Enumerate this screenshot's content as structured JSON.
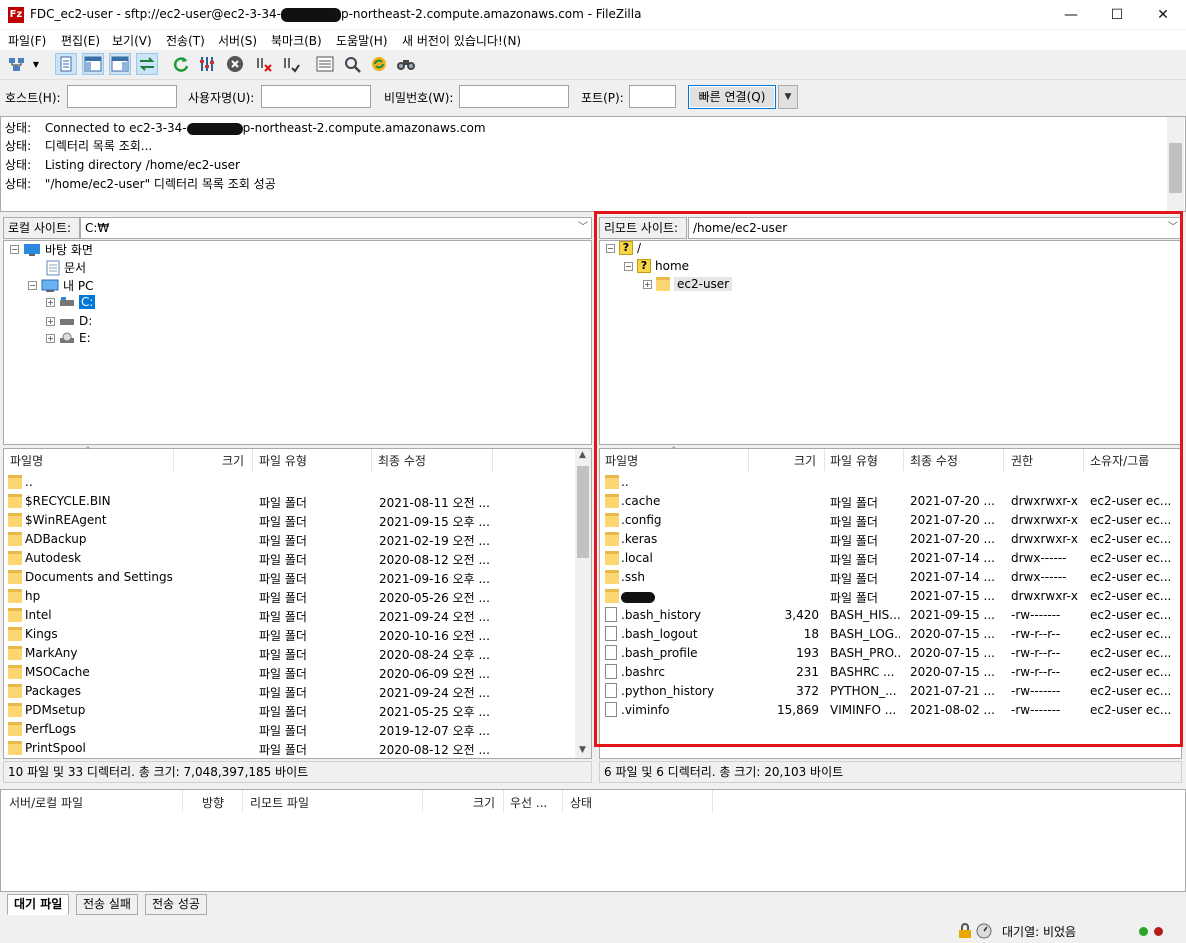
{
  "window": {
    "title_prefix": "FDC_ec2-user - sftp://ec2-user@ec2-3-34-",
    "title_suffix": "p-northeast-2.compute.amazonaws.com - FileZilla",
    "app_icon": "Fz",
    "controls": [
      "—",
      "☐",
      "✕"
    ]
  },
  "menu": [
    "파일(F)",
    "편집(E)",
    "보기(V)",
    "전송(T)",
    "서버(S)",
    "북마크(B)",
    "도움말(H)",
    "새 버전이 있습니다!(N)"
  ],
  "toolbar": {
    "icons": [
      "site-manager-icon",
      "dropdown-arrow-icon",
      "toggle-message-log-icon",
      "toggle-local-tree-icon",
      "toggle-remote-tree-icon",
      "toggle-transfer-queue-icon",
      "refresh-icon",
      "process-queue-icon",
      "cancel-icon",
      "disconnect-icon",
      "reconnect-icon",
      "directory-listing-filter-icon",
      "toggle-comparison-icon",
      "sync-browsing-icon",
      "search-binoculars-icon"
    ]
  },
  "quickconnect": {
    "host_label": "호스트(H):",
    "user_label": "사용자명(U):",
    "pass_label": "비밀번호(W):",
    "port_label": "포트(P):",
    "host_value": "",
    "user_value": "",
    "pass_value": "",
    "port_value": "",
    "connect_label": "빠른 연결(Q)"
  },
  "log": [
    {
      "key": "상태:",
      "prefix": "Connected to ec2-3-34-",
      "suffix": "p-northeast-2.compute.amazonaws.com"
    },
    {
      "key": "상태:",
      "prefix": "디렉터리 목록 조회...",
      "suffix": ""
    },
    {
      "key": "상태:",
      "prefix": "Listing directory /home/ec2-user",
      "suffix": ""
    },
    {
      "key": "상태:",
      "prefix": "\"/home/ec2-user\" 디렉터리 목록 조회 성공",
      "suffix": ""
    }
  ],
  "local": {
    "site_label": "로컬 사이트:",
    "path": "C:₩",
    "tree": [
      {
        "label": "바탕 화면",
        "icon": "desktop-icon",
        "expander": "⊟"
      },
      {
        "label": "문서",
        "icon": "document-icon",
        "expander": ""
      },
      {
        "label": "내 PC",
        "icon": "pc-icon",
        "expander": "⊟"
      },
      {
        "label": "C:",
        "icon": "drive-icon",
        "expander": "⊞"
      },
      {
        "label": "D:",
        "icon": "drive-icon",
        "expander": "⊞"
      },
      {
        "label": "E:",
        "icon": "cd-drive-icon",
        "expander": "⊞"
      }
    ],
    "columns": [
      "파일명",
      "크기",
      "파일 유형",
      "최종 수정"
    ],
    "files": [
      {
        "name": "..",
        "size": "",
        "type": "",
        "modified": ""
      },
      {
        "name": "$RECYCLE.BIN",
        "size": "",
        "type": "파일 폴더",
        "modified": "2021-08-11 오전 ..."
      },
      {
        "name": "$WinREAgent",
        "size": "",
        "type": "파일 폴더",
        "modified": "2021-09-15 오후 ..."
      },
      {
        "name": "ADBackup",
        "size": "",
        "type": "파일 폴더",
        "modified": "2021-02-19 오전 ..."
      },
      {
        "name": "Autodesk",
        "size": "",
        "type": "파일 폴더",
        "modified": "2020-08-12 오전 ..."
      },
      {
        "name": "Documents and Settings",
        "size": "",
        "type": "파일 폴더",
        "modified": "2021-09-16 오후 ..."
      },
      {
        "name": "hp",
        "size": "",
        "type": "파일 폴더",
        "modified": "2020-05-26 오전 ..."
      },
      {
        "name": "Intel",
        "size": "",
        "type": "파일 폴더",
        "modified": "2021-09-24 오전 ..."
      },
      {
        "name": "Kings",
        "size": "",
        "type": "파일 폴더",
        "modified": "2020-10-16 오전 ..."
      },
      {
        "name": "MarkAny",
        "size": "",
        "type": "파일 폴더",
        "modified": "2020-08-24 오후 ..."
      },
      {
        "name": "MSOCache",
        "size": "",
        "type": "파일 폴더",
        "modified": "2020-06-09 오전 ..."
      },
      {
        "name": "Packages",
        "size": "",
        "type": "파일 폴더",
        "modified": "2021-09-24 오전 ..."
      },
      {
        "name": "PDMsetup",
        "size": "",
        "type": "파일 폴더",
        "modified": "2021-05-25 오후 ..."
      },
      {
        "name": "PerfLogs",
        "size": "",
        "type": "파일 폴더",
        "modified": "2019-12-07 오후 ..."
      },
      {
        "name": "PrintSpool",
        "size": "",
        "type": "파일 폴더",
        "modified": "2020-08-12 오전 ..."
      }
    ],
    "status": "10 파일 및 33 디렉터리. 총 크기: 7,048,397,185 바이트"
  },
  "remote": {
    "site_label": "리모트 사이트:",
    "path": "/home/ec2-user",
    "tree": [
      {
        "label": "/",
        "expander": "⊟"
      },
      {
        "label": "home",
        "expander": "⊟"
      },
      {
        "label": "ec2-user",
        "expander": "⊞"
      }
    ],
    "columns": [
      "파일명",
      "크기",
      "파일 유형",
      "최종 수정",
      "권한",
      "소유자/그룹"
    ],
    "files": [
      {
        "name": "..",
        "size": "",
        "type": "",
        "modified": "",
        "perms": "",
        "owner": "",
        "kind": "folder"
      },
      {
        "name": ".cache",
        "size": "",
        "type": "파일 폴더",
        "modified": "2021-07-20 ...",
        "perms": "drwxrwxr-x",
        "owner": "ec2-user ec...",
        "kind": "folder"
      },
      {
        "name": ".config",
        "size": "",
        "type": "파일 폴더",
        "modified": "2021-07-20 ...",
        "perms": "drwxrwxr-x",
        "owner": "ec2-user ec...",
        "kind": "folder"
      },
      {
        "name": ".keras",
        "size": "",
        "type": "파일 폴더",
        "modified": "2021-07-20 ...",
        "perms": "drwxrwxr-x",
        "owner": "ec2-user ec...",
        "kind": "folder"
      },
      {
        "name": ".local",
        "size": "",
        "type": "파일 폴더",
        "modified": "2021-07-14 ...",
        "perms": "drwx------",
        "owner": "ec2-user ec...",
        "kind": "folder"
      },
      {
        "name": ".ssh",
        "size": "",
        "type": "파일 폴더",
        "modified": "2021-07-14 ...",
        "perms": "drwx------",
        "owner": "ec2-user ec...",
        "kind": "folder"
      },
      {
        "name": "",
        "size": "",
        "type": "파일 폴더",
        "modified": "2021-07-15 ...",
        "perms": "drwxrwxr-x",
        "owner": "ec2-user ec...",
        "kind": "folder-redacted"
      },
      {
        "name": ".bash_history",
        "size": "3,420",
        "type": "BASH_HIS...",
        "modified": "2021-09-15 ...",
        "perms": "-rw-------",
        "owner": "ec2-user ec...",
        "kind": "file"
      },
      {
        "name": ".bash_logout",
        "size": "18",
        "type": "BASH_LOG...",
        "modified": "2020-07-15 ...",
        "perms": "-rw-r--r--",
        "owner": "ec2-user ec...",
        "kind": "file"
      },
      {
        "name": ".bash_profile",
        "size": "193",
        "type": "BASH_PRO...",
        "modified": "2020-07-15 ...",
        "perms": "-rw-r--r--",
        "owner": "ec2-user ec...",
        "kind": "file"
      },
      {
        "name": ".bashrc",
        "size": "231",
        "type": "BASHRC ...",
        "modified": "2020-07-15 ...",
        "perms": "-rw-r--r--",
        "owner": "ec2-user ec...",
        "kind": "file"
      },
      {
        "name": ".python_history",
        "size": "372",
        "type": "PYTHON_...",
        "modified": "2021-07-21 ...",
        "perms": "-rw-------",
        "owner": "ec2-user ec...",
        "kind": "file"
      },
      {
        "name": ".viminfo",
        "size": "15,869",
        "type": "VIMINFO ...",
        "modified": "2021-08-02 ...",
        "perms": "-rw-------",
        "owner": "ec2-user ec...",
        "kind": "file"
      }
    ],
    "status": "6 파일 및 6 디렉터리. 총 크기: 20,103 바이트"
  },
  "queue": {
    "columns": [
      "서버/로컬 파일",
      "방향",
      "리모트 파일",
      "크기",
      "우선 ...",
      "상태"
    ],
    "tabs": [
      "대기 파일",
      "전송 실패",
      "전송 성공"
    ],
    "queue_status": "대기열: 비었음"
  },
  "colors": {
    "highlight": "#e3151a",
    "accent": "#0078d7"
  }
}
